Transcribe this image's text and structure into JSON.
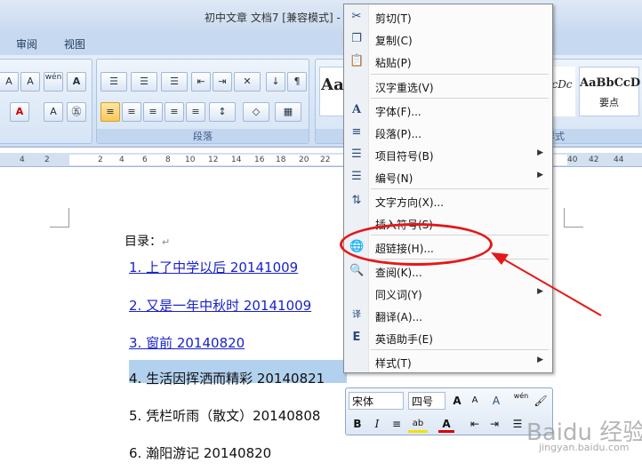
{
  "window": {
    "title": "初中文章 文档7 [兼容模式] -"
  },
  "ribbon": {
    "tabs": [
      "审阅",
      "视图"
    ],
    "groups": {
      "paragraph": "段落",
      "styles": "样式"
    },
    "style_items": [
      {
        "preview": "Aa",
        "name": ""
      },
      {
        "preview": "cDc",
        "name": ""
      },
      {
        "preview": "AaBbCcD",
        "name": "要点"
      }
    ],
    "font_button": "A",
    "change_case": "wén\n变"
  },
  "ruler": {
    "ticks": [
      "4",
      "2",
      "2",
      "4",
      "6",
      "8",
      "10",
      "12",
      "14",
      "16",
      "18",
      "20",
      "22",
      "40",
      "42",
      "44"
    ]
  },
  "document": {
    "heading": "目录：",
    "lines": [
      {
        "text": "1. 上了中学以后  20141009",
        "link": true
      },
      {
        "text": "2. 又是一年中秋时  20141009",
        "link": true
      },
      {
        "text": "3. 窗前  20140820",
        "link": true
      },
      {
        "text": "4. 生活因挥洒而精彩 20140821",
        "link": false
      },
      {
        "text": "5. 凭栏听雨（散文）20140808",
        "link": false
      },
      {
        "text": "6. 瀚阳游记 20140820",
        "link": false
      }
    ]
  },
  "context_menu": {
    "items": [
      {
        "label": "剪切(T)",
        "icon": "scissors-icon",
        "glyph": "✂"
      },
      {
        "label": "复制(C)",
        "icon": "copy-icon",
        "glyph": "❐"
      },
      {
        "label": "粘贴(P)",
        "icon": "paste-icon",
        "glyph": "📋"
      },
      {
        "label": "汉字重选(V)",
        "icon": "",
        "glyph": ""
      },
      {
        "label": "字体(F)...",
        "icon": "font-icon",
        "glyph": "A"
      },
      {
        "label": "段落(P)...",
        "icon": "paragraph-icon",
        "glyph": "≡"
      },
      {
        "label": "项目符号(B)",
        "icon": "bullets-icon",
        "glyph": "☰",
        "submenu": true
      },
      {
        "label": "编号(N)",
        "icon": "numbering-icon",
        "glyph": "☰",
        "submenu": true
      },
      {
        "label": "文字方向(X)...",
        "icon": "text-direction-icon",
        "glyph": "⇅"
      },
      {
        "label": "插入符号(S)",
        "icon": "",
        "glyph": ""
      },
      {
        "label": "超链接(H)...",
        "icon": "hyperlink-icon",
        "glyph": "🌐"
      },
      {
        "label": "查阅(K)...",
        "icon": "research-icon",
        "glyph": "🔍"
      },
      {
        "label": "同义词(Y)",
        "icon": "",
        "glyph": "",
        "submenu": true
      },
      {
        "label": "翻译(A)...",
        "icon": "translate-icon",
        "glyph": "译"
      },
      {
        "label": "英语助手(E)",
        "icon": "english-assistant-icon",
        "glyph": "E"
      },
      {
        "label": "样式(T)",
        "icon": "",
        "glyph": "",
        "submenu": true
      }
    ]
  },
  "mini_toolbar": {
    "font_name": "宋体",
    "font_size": "四号",
    "grow": "A",
    "shrink": "A",
    "bold": "B",
    "italic": "I",
    "font_color": "A",
    "highlight": "ab",
    "phonetic": "wén"
  },
  "watermark": {
    "text": "Baidu 经验",
    "sub": "jingyan.baidu.com"
  },
  "colors": {
    "annotation": "#e41818",
    "link": "#1a22c9",
    "selection": "#b2d1ee"
  }
}
